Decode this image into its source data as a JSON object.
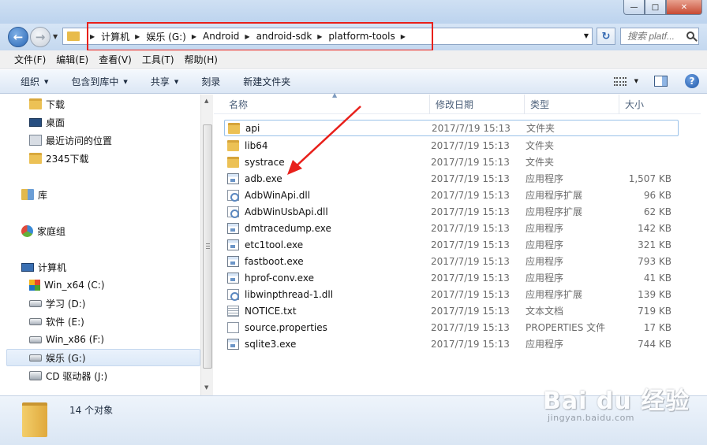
{
  "address": {
    "crumbs": [
      "计算机",
      "娱乐 (G:)",
      "Android",
      "android-sdk",
      "platform-tools"
    ],
    "search_placeholder": "搜索 platf..."
  },
  "menu": [
    "文件(F)",
    "编辑(E)",
    "查看(V)",
    "工具(T)",
    "帮助(H)"
  ],
  "toolbar": {
    "organize": "组织",
    "include_library": "包含到库中",
    "share": "共享",
    "burn": "刻录",
    "new_folder": "新建文件夹"
  },
  "sidebar": [
    {
      "label": "下载",
      "icon": "folder-icon"
    },
    {
      "label": "桌面",
      "icon": "desktop-icon"
    },
    {
      "label": "最近访问的位置",
      "icon": "recent-places-icon"
    },
    {
      "label": "2345下载",
      "icon": "folder-icon"
    },
    {
      "label": "库",
      "icon": "library-icon"
    },
    {
      "label": "家庭组",
      "icon": "homegroup-icon"
    },
    {
      "label": "计算机",
      "icon": "computer-icon"
    },
    {
      "label": "Win_x64 (C:)",
      "icon": "system-drive-icon"
    },
    {
      "label": "学习 (D:)",
      "icon": "drive-icon"
    },
    {
      "label": "软件 (E:)",
      "icon": "drive-icon"
    },
    {
      "label": "Win_x86 (F:)",
      "icon": "drive-icon"
    },
    {
      "label": "娱乐 (G:)",
      "icon": "drive-icon",
      "selected": true
    },
    {
      "label": "CD 驱动器 (J:)",
      "icon": "cd-drive-icon"
    }
  ],
  "columns": {
    "name": "名称",
    "date": "修改日期",
    "type": "类型",
    "size": "大小"
  },
  "files": [
    {
      "name": "api",
      "date": "2017/7/19 15:13",
      "type": "文件夹",
      "size": "",
      "icon": "folder-icon"
    },
    {
      "name": "lib64",
      "date": "2017/7/19 15:13",
      "type": "文件夹",
      "size": "",
      "icon": "folder-icon"
    },
    {
      "name": "systrace",
      "date": "2017/7/19 15:13",
      "type": "文件夹",
      "size": "",
      "icon": "folder-icon"
    },
    {
      "name": "adb.exe",
      "date": "2017/7/19 15:13",
      "type": "应用程序",
      "size": "1,507 KB",
      "icon": "exe-icon"
    },
    {
      "name": "AdbWinApi.dll",
      "date": "2017/7/19 15:13",
      "type": "应用程序扩展",
      "size": "96 KB",
      "icon": "dll-icon"
    },
    {
      "name": "AdbWinUsbApi.dll",
      "date": "2017/7/19 15:13",
      "type": "应用程序扩展",
      "size": "62 KB",
      "icon": "dll-icon"
    },
    {
      "name": "dmtracedump.exe",
      "date": "2017/7/19 15:13",
      "type": "应用程序",
      "size": "142 KB",
      "icon": "exe-icon"
    },
    {
      "name": "etc1tool.exe",
      "date": "2017/7/19 15:13",
      "type": "应用程序",
      "size": "321 KB",
      "icon": "exe-icon"
    },
    {
      "name": "fastboot.exe",
      "date": "2017/7/19 15:13",
      "type": "应用程序",
      "size": "793 KB",
      "icon": "exe-icon"
    },
    {
      "name": "hprof-conv.exe",
      "date": "2017/7/19 15:13",
      "type": "应用程序",
      "size": "41 KB",
      "icon": "exe-icon"
    },
    {
      "name": "libwinpthread-1.dll",
      "date": "2017/7/19 15:13",
      "type": "应用程序扩展",
      "size": "139 KB",
      "icon": "dll-icon"
    },
    {
      "name": "NOTICE.txt",
      "date": "2017/7/19 15:13",
      "type": "文本文档",
      "size": "719 KB",
      "icon": "text-file-icon"
    },
    {
      "name": "source.properties",
      "date": "2017/7/19 15:13",
      "type": "PROPERTIES 文件",
      "size": "17 KB",
      "icon": "document-icon"
    },
    {
      "name": "sqlite3.exe",
      "date": "2017/7/19 15:13",
      "type": "应用程序",
      "size": "744 KB",
      "icon": "exe-icon"
    }
  ],
  "status": {
    "count_text": "14 个对象"
  },
  "watermark": {
    "brand": "Bai du 经验",
    "url": "jingyan.baidu.com"
  },
  "colors": {
    "annotation_red": "#e8201b",
    "selection_blue": "#dce9f8"
  }
}
